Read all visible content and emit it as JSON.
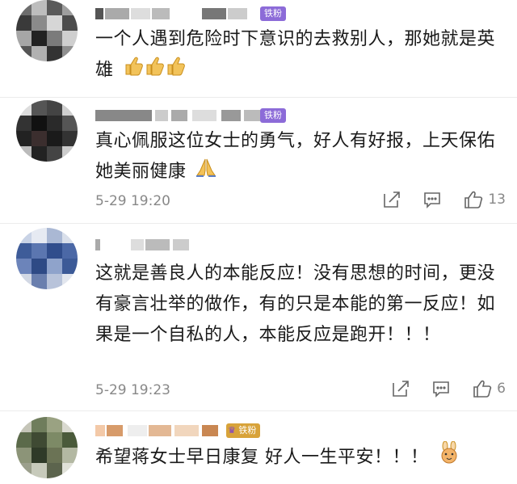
{
  "badges": {
    "fan": "铁粉"
  },
  "comments": [
    {
      "text": "一个人遇到危险时下意识的去救别人，那她就是英雄",
      "emoji": "thumbs-up-icon x3"
    },
    {
      "text": "真心佩服这位女士的勇气，好人有好报，上天保佑她美丽健康",
      "emoji": "praying-hands-icon",
      "time": "5-29 19:20",
      "likes": "13"
    },
    {
      "text": "这就是善良人的本能反应！没有思想的时间，更没有豪言壮举的做作，有的只是本能的第一反应！如果是一个自私的人，本能反应是跑开！！！",
      "time": "5-29 19:23",
      "likes": "6"
    },
    {
      "text": "希望蒋女士早日康复 好人一生平安！！！",
      "emoji": "rabbit-face-icon"
    }
  ],
  "colors": {
    "badge_purple": "#8c6bd8",
    "badge_gold": "#d8a33a",
    "meta_gray": "#888888"
  }
}
